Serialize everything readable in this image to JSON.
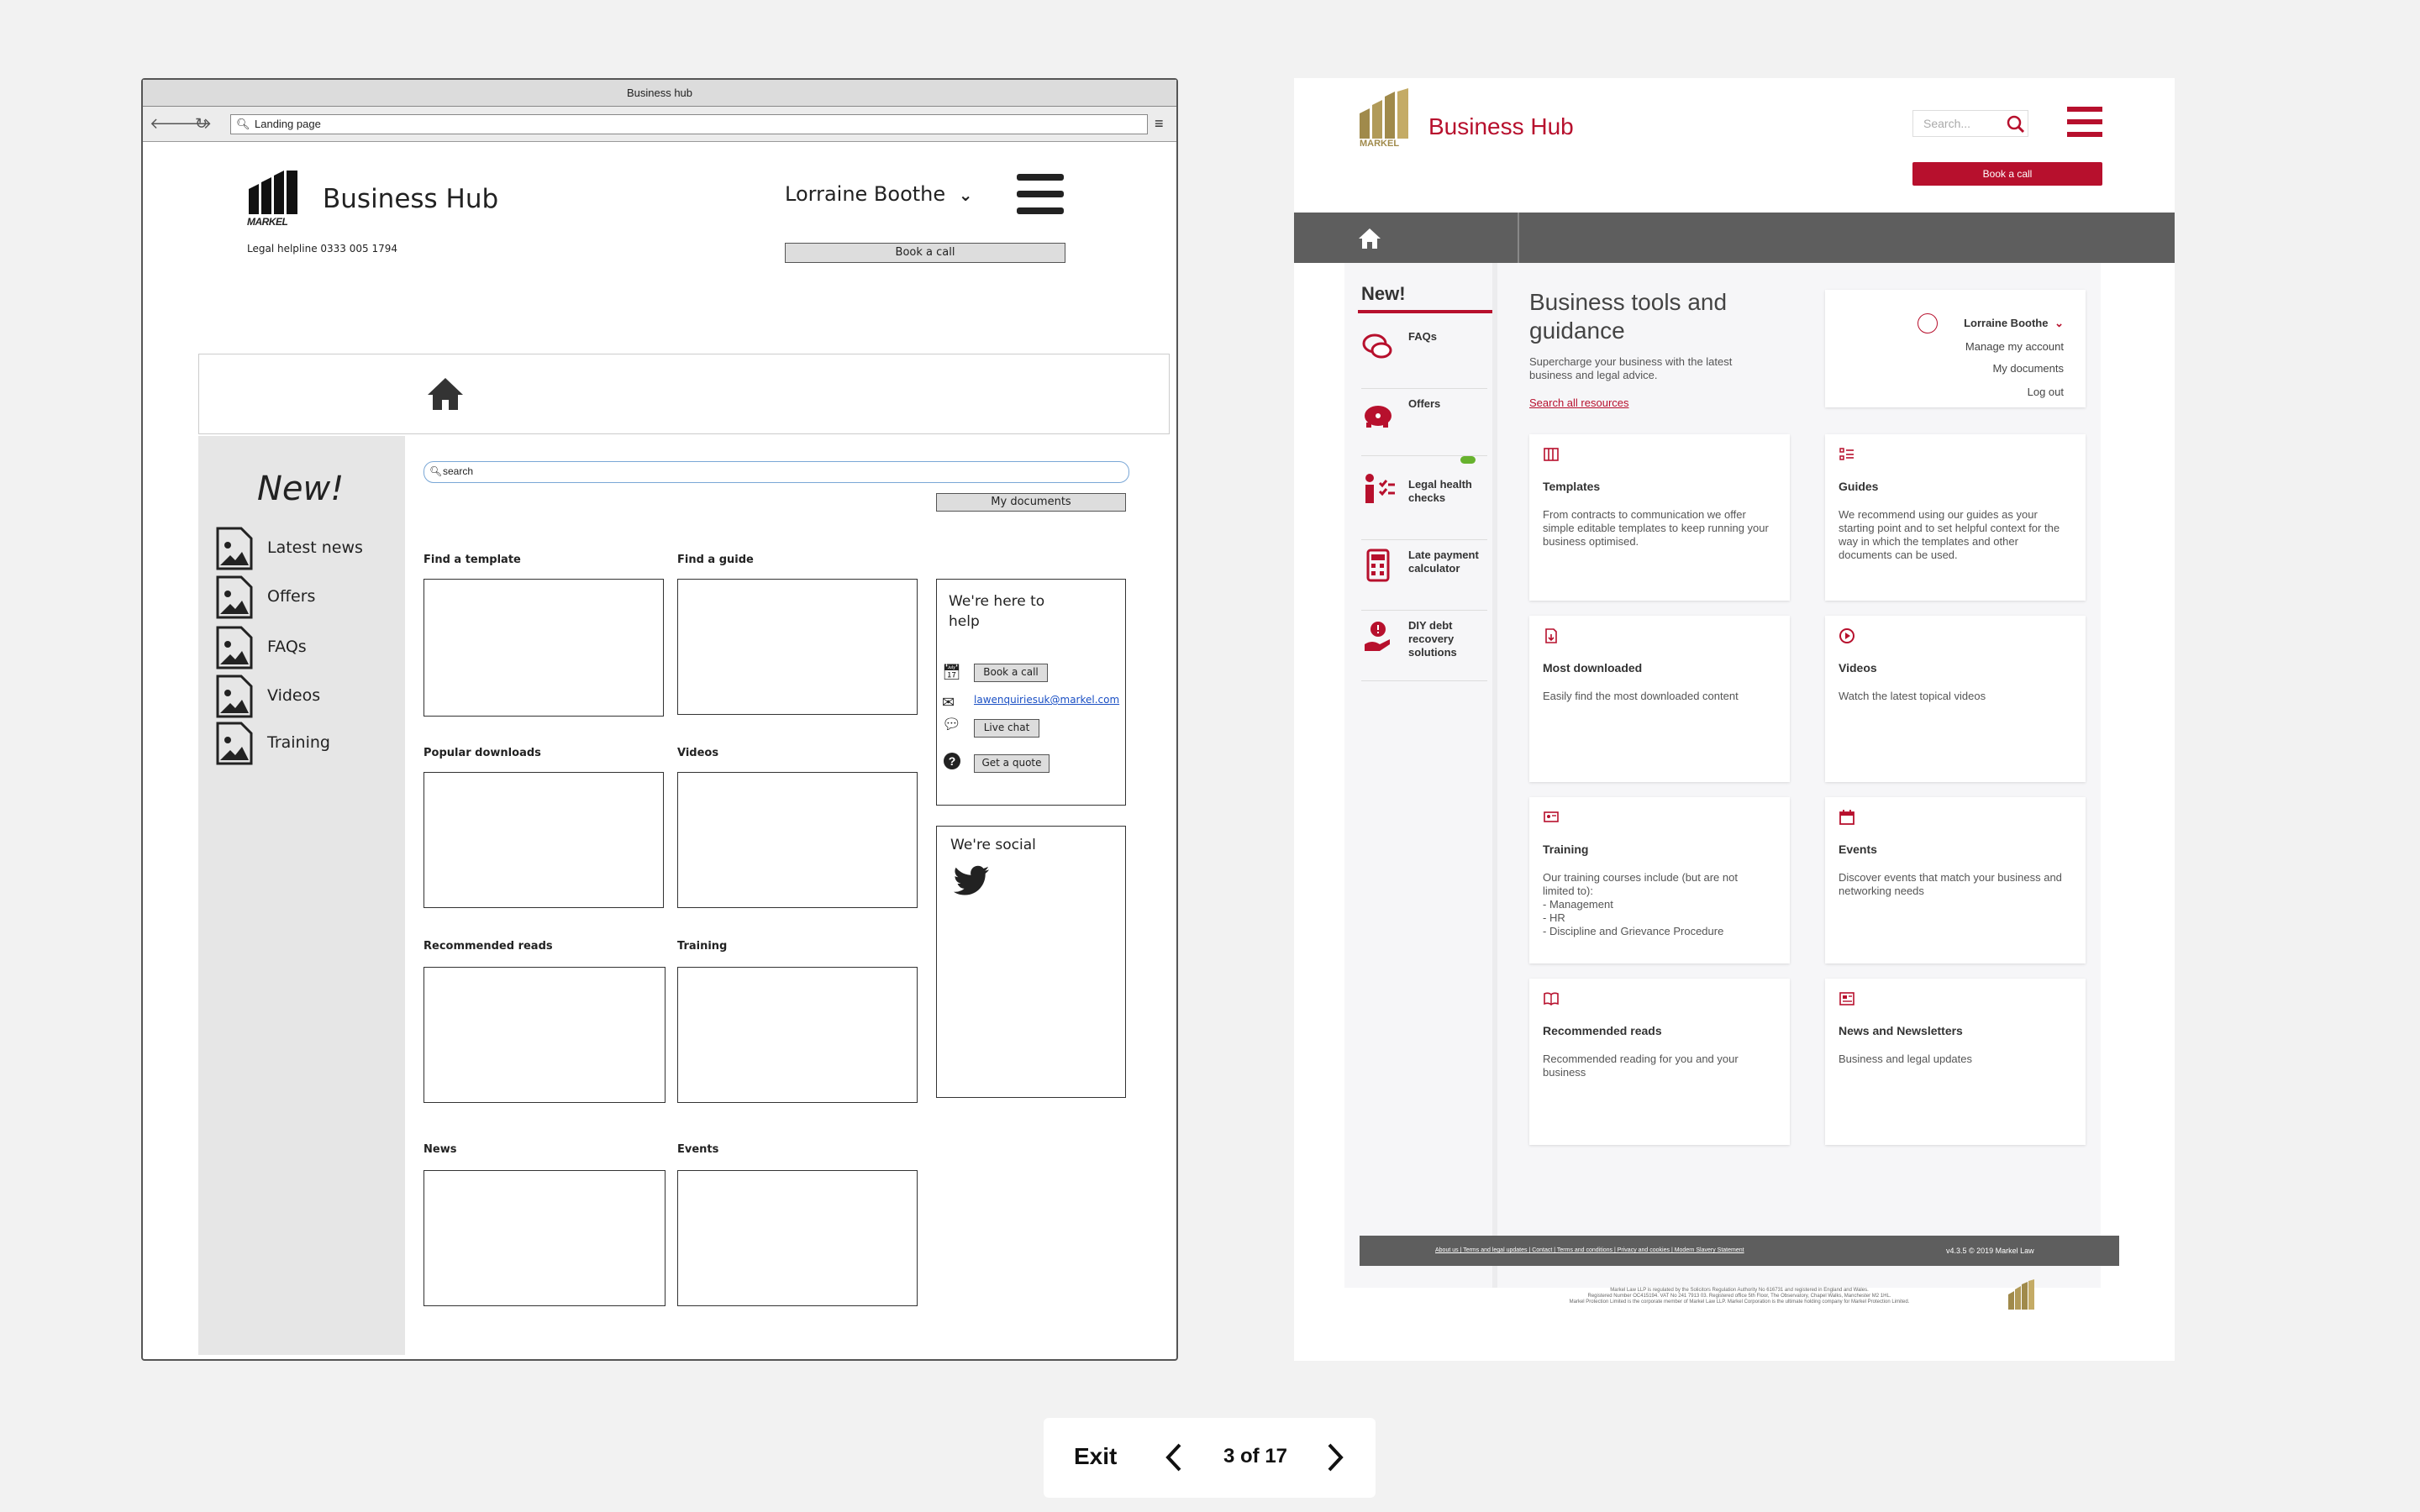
{
  "wireframe": {
    "window_title": "Business hub",
    "url": "Landing page",
    "logo_text": "MARKEL",
    "brand": "Business Hub",
    "helpline": "Legal helpline 0333 005 1794",
    "user_name": "Lorraine Boothe",
    "book_call": "Book a call",
    "new_heading": "New!",
    "side_items": [
      "Latest news",
      "Offers",
      "FAQs",
      "Videos",
      "Training"
    ],
    "search_placeholder": "search",
    "my_documents": "My documents",
    "sections": [
      "Find a template",
      "Find a guide",
      "Popular downloads",
      "Videos",
      "Recommended reads",
      "Training",
      "News",
      "Events"
    ],
    "help": {
      "title": "We're here to help",
      "book": "Book a call",
      "email": "lawenquiriesuk@markel.com",
      "chat": "Live chat",
      "quote": "Get a quote"
    },
    "social_title": "We're social"
  },
  "design": {
    "logo_text": "MARKEL",
    "brand": "Business Hub",
    "search_placeholder": "Search...",
    "book_call": "Book a call",
    "new_heading": "New!",
    "nav": [
      {
        "label": "FAQs",
        "icon": "faq-icon"
      },
      {
        "label": "Offers",
        "icon": "piggy-bank-icon"
      },
      {
        "label": "Legal health checks",
        "icon": "checklist-icon"
      },
      {
        "label": "Late payment calculator",
        "icon": "calculator-icon"
      },
      {
        "label": "DIY debt recovery solutions",
        "icon": "debt-icon"
      }
    ],
    "intro": {
      "title": "Business tools and guidance",
      "text": "Supercharge your business with the latest business and legal advice.",
      "link": "Search all resources"
    },
    "account": {
      "name": "Lorraine Boothe",
      "links": [
        "Manage my account",
        "My documents",
        "Log out"
      ]
    },
    "cards": [
      {
        "title": "Templates",
        "desc": "From contracts to communication we offer simple editable templates to keep running your business optimised.",
        "icon": "template-icon"
      },
      {
        "title": "Guides",
        "desc": "We recommend using our guides as your starting point and to set helpful context for the way in which the templates and other documents can be used.",
        "icon": "guide-icon"
      },
      {
        "title": "Most downloaded",
        "desc": "Easily find the most downloaded content",
        "icon": "download-icon"
      },
      {
        "title": "Videos",
        "desc": "Watch the latest topical videos",
        "icon": "play-icon"
      },
      {
        "title": "Training",
        "desc": "Our training courses include (but are not limited to):\n- Management\n- HR\n- Discipline and Grievance Procedure",
        "icon": "training-icon"
      },
      {
        "title": "Events",
        "desc": "Discover events that match your business and networking needs",
        "icon": "calendar-icon"
      },
      {
        "title": "Recommended reads",
        "desc": "Recommended reading for you and your business",
        "icon": "book-icon"
      },
      {
        "title": "News and Newsletters",
        "desc": "Business and legal updates",
        "icon": "news-icon"
      }
    ],
    "footer_links": "About us | Terms and legal updates | Contact | Terms and conditions | Privacy and cookies | Modern Slavery Statement",
    "footer_version": "v4.3.5 © 2019 Markel Law",
    "footer_legal_1": "Markel Law LLP is regulated by the Solicitors Regulation Authority No 616731 and registered in England and Wales.",
    "footer_legal_2": "Registered Number OC415194. VAT No 241 7913 03. Registered office 5th Floor, The Observatory, Chapel Walks, Manchester M2 1HL.",
    "footer_legal_3": "Markel Protection Limited is the corporate member of Markel Law LLP. Markel Corporation is the ultimate holding company for Markel Protection Limited."
  },
  "pager": {
    "exit": "Exit",
    "status": "3 of 17"
  },
  "colors": {
    "brand_red": "#b7102d",
    "nav_grey": "#5e5e5e",
    "gold": "#a08a4b"
  }
}
